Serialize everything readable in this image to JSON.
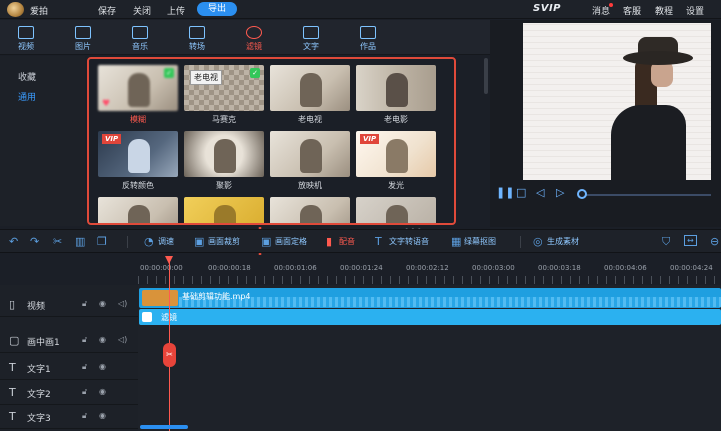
{
  "titlebar": {
    "app_name": "爱拍",
    "menu": [
      "保存",
      "关闭",
      "上传"
    ],
    "export_label": "导出",
    "svip": "SVIP",
    "right_menu": [
      "消息",
      "客服",
      "教程",
      "设置"
    ]
  },
  "categories": [
    {
      "label": "视频",
      "icon": "video-icon"
    },
    {
      "label": "图片",
      "icon": "image-icon"
    },
    {
      "label": "音乐",
      "icon": "music-icon"
    },
    {
      "label": "转场",
      "icon": "transition-icon"
    },
    {
      "label": "滤镜",
      "icon": "filter-icon",
      "active": true
    },
    {
      "label": "文字",
      "icon": "text-icon"
    },
    {
      "label": "作品",
      "icon": "folder-icon"
    }
  ],
  "left_nav": [
    "收藏",
    "通用"
  ],
  "filters": [
    {
      "label": "模糊",
      "badge": "green",
      "heart": true,
      "selected": true
    },
    {
      "label": "马赛克",
      "badge": "green"
    },
    {
      "label": "老电视"
    },
    {
      "label": "老电影"
    },
    {
      "label": "反转颜色",
      "badge": "VIP"
    },
    {
      "label": "聚影"
    },
    {
      "label": "放映机"
    },
    {
      "label": "发光",
      "badge": "VIP"
    },
    {
      "label": ""
    },
    {
      "label": ""
    },
    {
      "label": ""
    },
    {
      "label": ""
    }
  ],
  "tooltip": "老电视",
  "toolbar": {
    "items": [
      "调速",
      "画面裁剪",
      "画面定格",
      "配音",
      "文字转语音",
      "绿幕抠图",
      "生成素材"
    ],
    "red_item": "配音"
  },
  "ruler": [
    "00:00:00:00",
    "00:00:00:18",
    "00:00:01:06",
    "00:00:01:24",
    "00:00:02:12",
    "00:00:03:00",
    "00:00:03:18",
    "00:00:04:06",
    "00:00:04:24"
  ],
  "tracks": [
    {
      "name": "视频",
      "icon": "film-icon"
    },
    {
      "name": "画中画1",
      "icon": "pip-icon"
    },
    {
      "name": "文字1",
      "icon": "text-icon"
    },
    {
      "name": "文字2",
      "icon": "text-icon"
    },
    {
      "name": "文字3",
      "icon": "text-icon"
    }
  ],
  "clip": {
    "name": "基础剪辑功能.mp4",
    "filter_label": "滤镜",
    "thumb_text": "—"
  },
  "colors": {
    "accent": "#2b8ff0",
    "highlight": "#e04a3a"
  }
}
